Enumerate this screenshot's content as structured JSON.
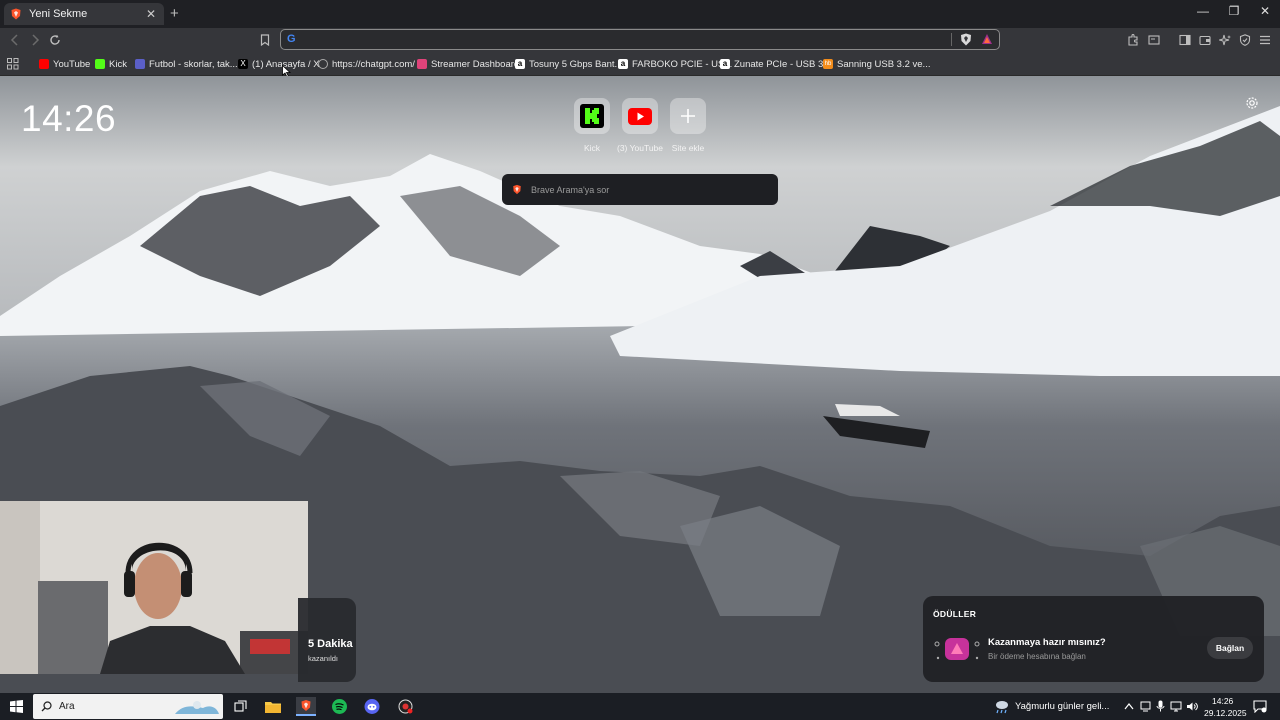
{
  "tab": {
    "title": "Yeni Sekme",
    "close": "✕"
  },
  "window": {
    "newtab": "+",
    "minimize": "—",
    "maximize": "❐",
    "close": "✕"
  },
  "omnibox": {
    "value": "",
    "placeholder": ""
  },
  "bookmarks": [
    {
      "label": "YouTube",
      "icon": "youtube-icon",
      "color": "#ff0000"
    },
    {
      "label": "Kick",
      "icon": "kick-icon",
      "color": "#53fc18"
    },
    {
      "label": "Futbol - skorlar, tak...",
      "icon": "futbol-icon",
      "color": "#5b5fc7"
    },
    {
      "label": "(1) Anasayfa / X",
      "icon": "x-icon",
      "color": "#000000"
    },
    {
      "label": "https://chatgpt.com/",
      "icon": "globe-icon",
      "color": "#888888"
    },
    {
      "label": "Streamer Dashboard",
      "icon": "streamer-icon",
      "color": "#e0437a"
    },
    {
      "label": "Tosuny 5 Gbps Bant...",
      "icon": "amazon-icon",
      "color": "#ffffff"
    },
    {
      "label": "FARBOKO PCIE - US...",
      "icon": "amazon-icon",
      "color": "#ffffff"
    },
    {
      "label": "Zunate PCIe - USB 3...",
      "icon": "amazon-icon",
      "color": "#ffffff"
    },
    {
      "label": "Sanning USB 3.2 ve...",
      "icon": "hb-icon",
      "color": "#f28c1b"
    }
  ],
  "clock": "14:26",
  "tiles": [
    {
      "label": "Kick",
      "icon": "kick-icon"
    },
    {
      "label": "(3) YouTube",
      "icon": "youtube-icon"
    },
    {
      "label": "Site ekle",
      "icon": "plus-icon"
    }
  ],
  "search": {
    "placeholder": "Brave Arama'ya sor"
  },
  "stats": {
    "value": "5 Dakika",
    "caption": "kazanıldı"
  },
  "rewards": {
    "header": "ÖDÜLLER",
    "question": "Kazanmaya hazır mısınız?",
    "subtitle": "Bir ödeme hesabına bağlan",
    "button": "Bağlan"
  },
  "taskbar": {
    "search_placeholder": "Ara",
    "weather": "Yağmurlu günler geli...",
    "time": "14:26",
    "date": "29.12.2025"
  },
  "colors": {
    "accent_brave": "#fb542b",
    "kick_green": "#53fc18",
    "youtube_red": "#ff0000"
  }
}
